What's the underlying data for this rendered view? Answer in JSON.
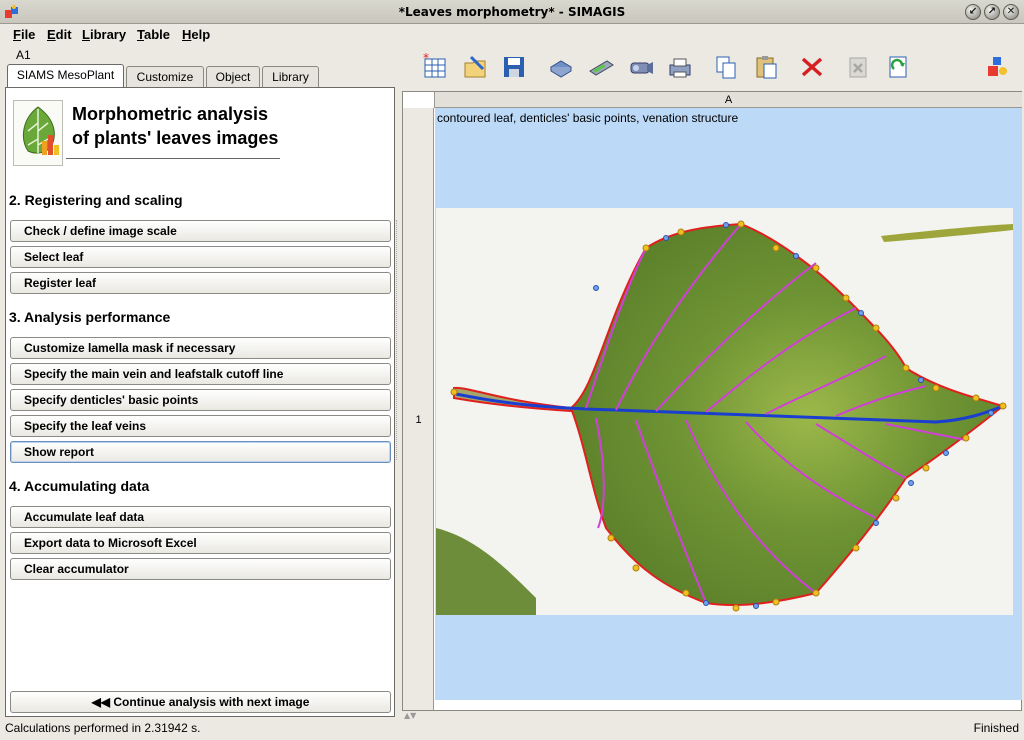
{
  "window": {
    "title": "*Leaves morphometry* - SIMAGIS"
  },
  "menu": [
    {
      "label": "File",
      "accel": "F"
    },
    {
      "label": "Edit",
      "accel": "E"
    },
    {
      "label": "Library",
      "accel": "L"
    },
    {
      "label": "Table",
      "accel": "T"
    },
    {
      "label": "Help",
      "accel": "H"
    }
  ],
  "left": {
    "cell_ref": "A1",
    "tabs": [
      "SIAMS MesoPlant",
      "Customize",
      "Object",
      "Library"
    ],
    "heading_line1": "Morphometric analysis",
    "heading_line2": "of plants' leaves images",
    "sections": [
      {
        "title": "2. Registering and scaling",
        "buttons": [
          "Check / define image scale",
          "Select leaf",
          "Register leaf"
        ]
      },
      {
        "title": "3. Analysis performance",
        "buttons": [
          "Customize lamella mask if necessary",
          "Specify the main vein and leafstalk cutoff line",
          "Specify denticles' basic points",
          "Specify the leaf veins",
          "Show report"
        ]
      },
      {
        "title": "4. Accumulating data",
        "buttons": [
          "Accumulate leaf data",
          "Export data to Microsoft Excel",
          "Clear accumulator"
        ]
      }
    ],
    "continue_label": "Continue analysis with next image"
  },
  "toolbar": {
    "icons": [
      "new-table-icon",
      "open-icon",
      "save-icon",
      "image-icon",
      "scanner-icon",
      "camera-icon",
      "print-icon",
      "copy-icon",
      "paste-icon",
      "delete-icon",
      "clear-icon",
      "refresh-icon",
      "info-icon"
    ]
  },
  "sheet": {
    "column_header": "A",
    "row_number": "1",
    "cell_text": "contoured leaf, denticles' basic points, venation structure"
  },
  "status": {
    "left": "Calculations performed in 2.31942 s.",
    "right": "Finished"
  },
  "colors": {
    "cell_bg": "#bcd9f8",
    "contour": "#e0201c",
    "vein_main": "#1a3fd0",
    "vein_side": "#d040d8",
    "point": "#f0c020"
  }
}
